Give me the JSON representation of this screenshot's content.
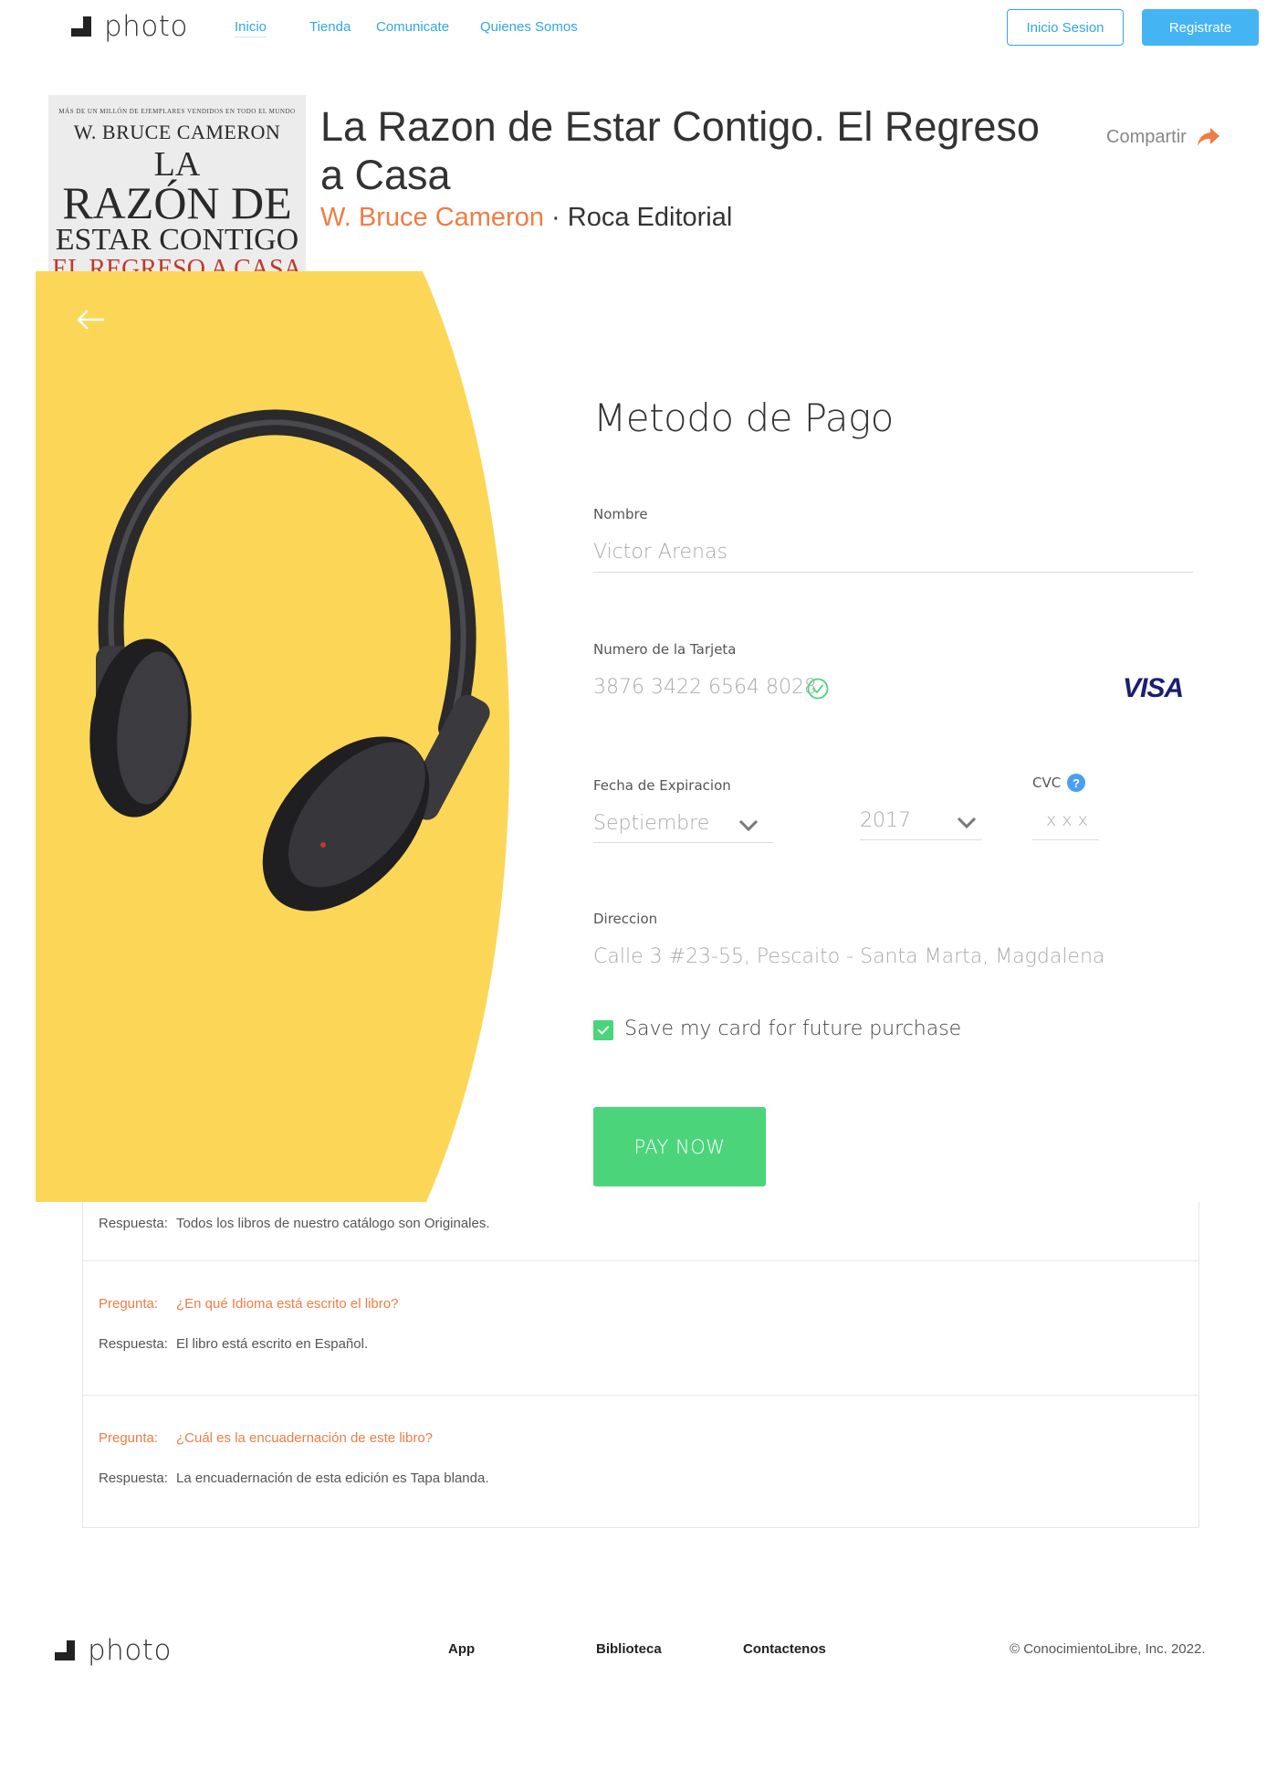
{
  "nav": {
    "logo_text": "photo",
    "links": [
      "Inicio",
      "Tienda",
      "Comunicate",
      "Quienes Somos"
    ],
    "login_label": "Inicio Sesion",
    "register_label": "Registrate",
    "accent_color": "#2fa8e6"
  },
  "book": {
    "cover": {
      "top_line": "MÁS DE UN MILLÓN DE EJEMPLARES VENDIDOS EN TODO EL MUNDO",
      "author": "W. BRUCE CAMERON",
      "title_line1": "LA",
      "title_line2": "RAZÓN DE",
      "title_line3": "ESTAR CONTIGO",
      "title_line4": "EL REGRESO A CASA"
    },
    "title": "La Razon de Estar Contigo. El Regreso a Casa",
    "author": "W. Bruce Cameron",
    "separator": "·",
    "publisher": "Roca Editorial",
    "share_label": "Compartir",
    "share_icon": "share-arrow-icon"
  },
  "payment": {
    "title": "Metodo de Pago",
    "back_icon": "arrow-left-icon",
    "panel_color": "#fcd757",
    "name_label": "Nombre",
    "name_value": "Victor Arenas",
    "card_label": "Numero de la Tarjeta",
    "card_value": "3876  3422 6564  8028",
    "card_brand": "VISA",
    "expiry_label": "Fecha de Expiracion",
    "expiry_month": "Septiembre",
    "expiry_year": "2017",
    "cvc_label": "CVC",
    "cvc_help": "?",
    "cvc_value": "x x x",
    "address_label": "Direccion",
    "address_value": "Calle 3 #23-55, Pescaito - Santa Marta, Magdalena",
    "save_card_label": "Save my card for future purchase",
    "save_card_checked": true,
    "pay_button": "PAY NOW",
    "pay_color": "#4cd47a"
  },
  "faq": {
    "question_tag": "Pregunta:",
    "answer_tag": "Respuesta:",
    "items": [
      {
        "question": "",
        "answer": "Todos los libros de nuestro catálogo son Originales."
      },
      {
        "question": "¿En qué Idioma está escrito el libro?",
        "answer": "El libro está escrito en Español."
      },
      {
        "question": "¿Cuál es la encuadernación de este libro?",
        "answer": "La encuadernación de esta edición es Tapa blanda."
      }
    ]
  },
  "footer": {
    "logo_text": "photo",
    "links": [
      "App",
      "Biblioteca",
      "Contactenos"
    ],
    "copyright": "© ConocimientoLibre, Inc. 2022."
  }
}
